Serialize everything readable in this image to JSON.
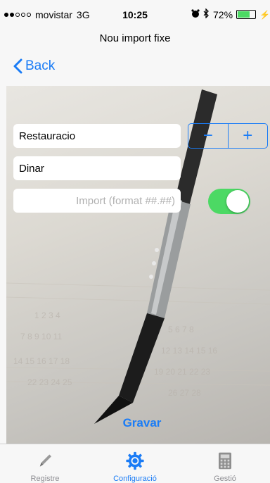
{
  "status_bar": {
    "carrier": "movistar",
    "network": "3G",
    "time": "10:25",
    "battery": "72%",
    "battery_level": 0.72
  },
  "nav": {
    "title": "Nou import fixe",
    "back_label": "Back"
  },
  "form": {
    "category_value": "Restauracio",
    "subcategory_value": "Dinar",
    "amount_placeholder": "Import (format ##.##)",
    "stepper_minus": "−",
    "stepper_plus": "+",
    "toggle_on": true
  },
  "actions": {
    "save_label": "Gravar"
  },
  "tabs": [
    {
      "label": "Registre",
      "icon": "pencil-icon",
      "active": false
    },
    {
      "label": "Configuració",
      "icon": "gear-icon",
      "active": true
    },
    {
      "label": "Gestió",
      "icon": "calculator-icon",
      "active": false
    }
  ],
  "colors": {
    "accent": "#1a7cf6",
    "toggle_on": "#4cd964"
  }
}
